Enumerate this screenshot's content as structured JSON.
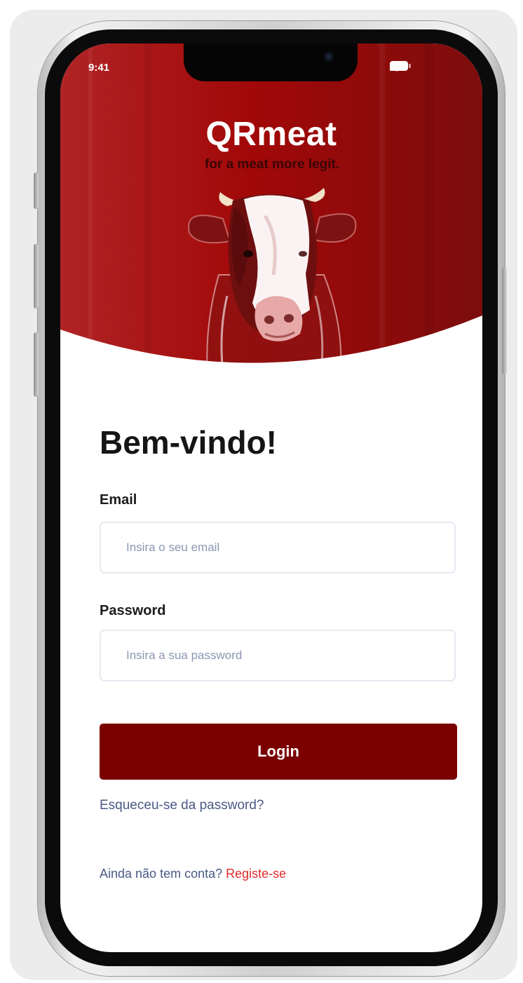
{
  "status_bar": {
    "time": "9:41",
    "icons": [
      "signal-icon",
      "wifi-icon",
      "battery-icon"
    ]
  },
  "hero": {
    "title": "QRmeat",
    "tagline": "for a meat more legit.",
    "image": "cow-illustration"
  },
  "login_form": {
    "heading": "Bem-vindo!",
    "email_label": "Email",
    "email_placeholder": "Insira o seu email",
    "password_label": "Password",
    "password_placeholder": "Insira a sua password",
    "login_button": "Login",
    "forgot_password": "Esqueceu-se da password?",
    "register_prompt": "Ainda não tem conta?",
    "register_link": "Registe-se"
  },
  "colors": {
    "brand_red": "#a10f0f",
    "button_red": "#7b0000",
    "link_red": "#e12b2b",
    "muted_text": "#4a5a85"
  }
}
